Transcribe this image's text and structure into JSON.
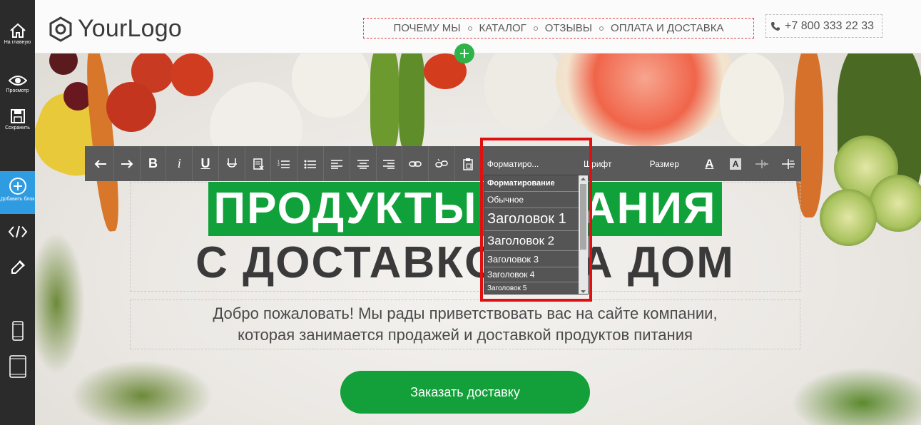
{
  "sidebar": {
    "items": [
      {
        "label": "На главную",
        "icon": "home-icon"
      },
      {
        "label": "Просмотр",
        "icon": "eye-icon"
      },
      {
        "label": "Сохранить",
        "icon": "save-icon"
      },
      {
        "label": "Добавить блок",
        "icon": "plus-circle-icon"
      },
      {
        "label": "",
        "icon": "code-icon"
      },
      {
        "label": "",
        "icon": "eyedropper-icon"
      },
      {
        "label": "",
        "icon": "phone-icon"
      },
      {
        "label": "",
        "icon": "tablet-icon"
      }
    ],
    "active_color": "#2f9be0"
  },
  "header": {
    "logo_text": "YourLogo",
    "nav": [
      "ПОЧЕМУ МЫ",
      "КАТАЛОГ",
      "ОТЗЫВЫ",
      "ОПЛАТА И ДОСТАВКА"
    ],
    "phone": "+7 800 333 22 33"
  },
  "toolbar": {
    "buttons": [
      "undo-icon",
      "redo-icon",
      "bold-icon",
      "italic-icon",
      "underline-icon",
      "strike-icon",
      "clear-format-icon",
      "ordered-list-icon",
      "bullet-list-icon",
      "align-left-icon",
      "align-center-icon",
      "align-right-icon",
      "link-icon",
      "unlink-icon",
      "paste-icon"
    ],
    "format_label": "Форматиро...",
    "font_label": "Шрифт",
    "size_label": "Размер",
    "text_color_label": "A",
    "bg_color_label": "A"
  },
  "format_dropdown": {
    "items": [
      "Форматирование",
      "Обычное",
      "Заголовок 1",
      "Заголовок 2",
      "Заголовок 3",
      "Заголовок 4",
      "Заголовок 5"
    ]
  },
  "hero": {
    "headline_1": "ПРОДУКТЫ ПИТАНИЯ",
    "headline_2": "С ДОСТАВКОЙ НА ДОМ",
    "subtitle_1": "Добро пожаловать! Мы рады приветствовать вас на сайте компании,",
    "subtitle_2": "которая занимается продажей и доставкой продуктов питания",
    "cta_label": "Заказать доставку",
    "accent_color": "#11a13a"
  }
}
